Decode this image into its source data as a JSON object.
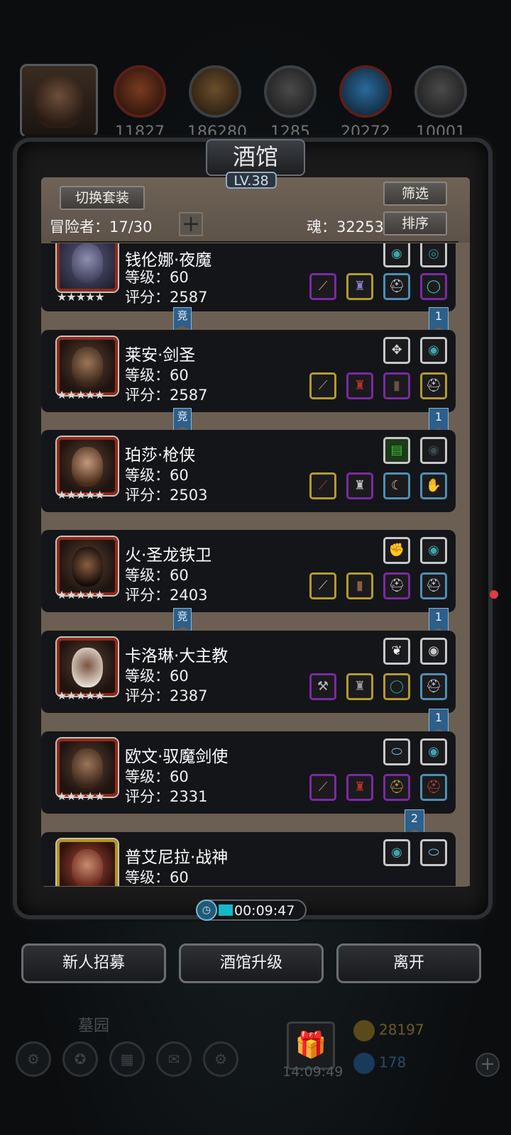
{
  "resources": [
    {
      "icon": "meat-icon",
      "value": "11827"
    },
    {
      "icon": "wood-icon",
      "value": "186280"
    },
    {
      "icon": "iron-icon",
      "value": "1285"
    },
    {
      "icon": "crystal-icon",
      "value": "20272"
    },
    {
      "icon": "stone-icon",
      "value": "10001"
    }
  ],
  "tavern": {
    "title": "酒馆",
    "level": "LV.38",
    "switch_outfit_label": "切换套装",
    "filter_label": "筛选",
    "sort_label": "排序",
    "adventurers_label": "冒险者：17/30",
    "soul_label": "魂：32253"
  },
  "heroes": [
    {
      "name": "钱伦娜·夜魔",
      "level": "等级：60",
      "score": "评分：2587",
      "stars": "★★★★★",
      "ribbon": "1",
      "competitive": "竞"
    },
    {
      "name": "莱安·剑圣",
      "level": "等级：60",
      "score": "评分：2587",
      "stars": "★★★★★",
      "ribbon": "1",
      "competitive": "竞"
    },
    {
      "name": "珀莎·枪侠",
      "level": "等级：60",
      "score": "评分：2503",
      "stars": "★★★★★",
      "ribbon": "",
      "competitive": ""
    },
    {
      "name": "火·圣龙铁卫",
      "level": "等级：60",
      "score": "评分：2403",
      "stars": "★★★★★",
      "ribbon": "1",
      "competitive": "竞"
    },
    {
      "name": "卡洛琳·大主教",
      "level": "等级：60",
      "score": "评分：2387",
      "stars": "★★★★★",
      "ribbon": "1",
      "competitive": ""
    },
    {
      "name": "欧文·驭魔剑使",
      "level": "等级：60",
      "score": "评分：2331",
      "stars": "★★★★★",
      "ribbon": "2",
      "competitive": ""
    },
    {
      "name": "普艾尼拉·战神",
      "level": "等级：60",
      "score": "",
      "stars": "★★★★★",
      "ribbon": "",
      "competitive": ""
    }
  ],
  "timer": "00:09:47",
  "actions": {
    "recruit": "新人招募",
    "upgrade": "酒馆升级",
    "leave": "离开"
  },
  "footer": {
    "area": "墓园",
    "time": "14:09:49",
    "gold": "28197",
    "gems": "178"
  }
}
